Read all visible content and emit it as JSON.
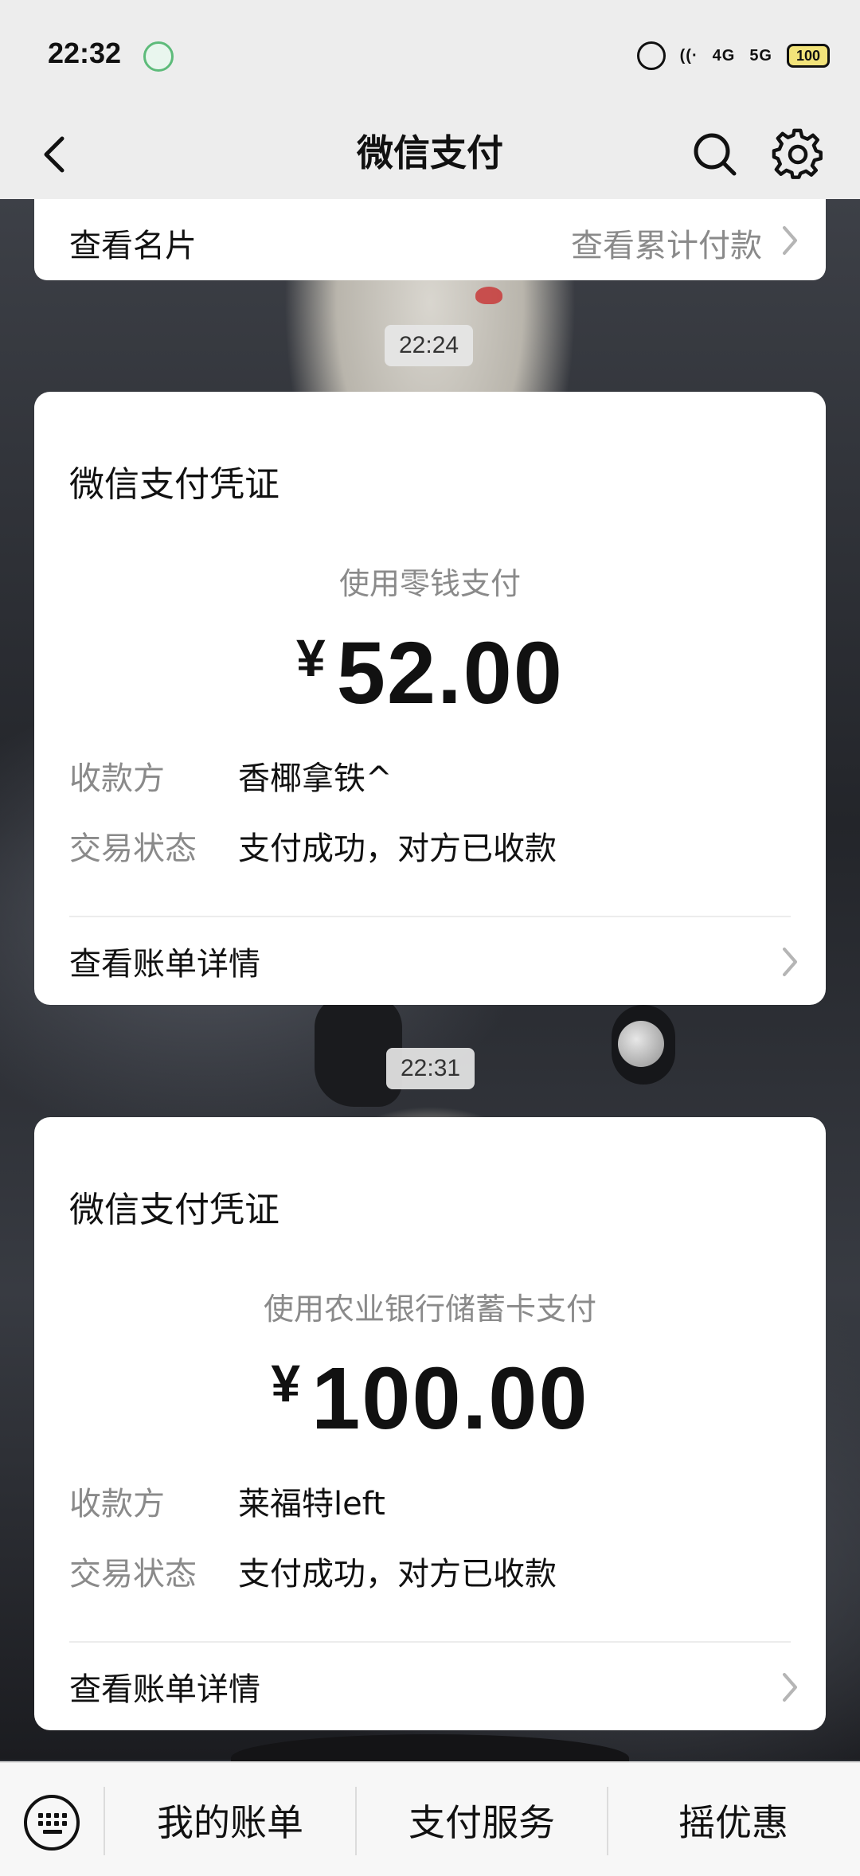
{
  "status_bar": {
    "time": "22:32",
    "battery": "100",
    "signal_4g": "4G",
    "signal_5g": "5G"
  },
  "nav": {
    "title": "微信支付",
    "icons": [
      "back-icon",
      "search-icon",
      "gear-icon"
    ]
  },
  "top_card": {
    "left_label": "查看名片",
    "right_label": "查看累计付款"
  },
  "messages": [
    {
      "timestamp": "22:24",
      "card_title": "微信支付凭证",
      "payment_method": "使用零钱支付",
      "currency": "¥",
      "amount": "52.00",
      "payee_label": "收款方",
      "payee": "香椰拿铁^",
      "status_label": "交易状态",
      "status": "支付成功，对方已收款",
      "detail_link": "查看账单详情"
    },
    {
      "timestamp": "22:31",
      "card_title": "微信支付凭证",
      "payment_method": "使用农业银行储蓄卡支付",
      "currency": "¥",
      "amount": "100.00",
      "payee_label": "收款方",
      "payee": "莱福特left",
      "status_label": "交易状态",
      "status": "支付成功，对方已收款",
      "detail_link": "查看账单详情"
    }
  ],
  "bottom_bar": {
    "tabs": [
      "我的账单",
      "支付服务",
      "摇优惠"
    ],
    "keyboard_icon": "keyboard-icon"
  },
  "colors": {
    "header_bg": "#ededed",
    "card_bg": "#ffffff",
    "secondary_text": "#8a8a8a",
    "primary_text": "#111111"
  }
}
